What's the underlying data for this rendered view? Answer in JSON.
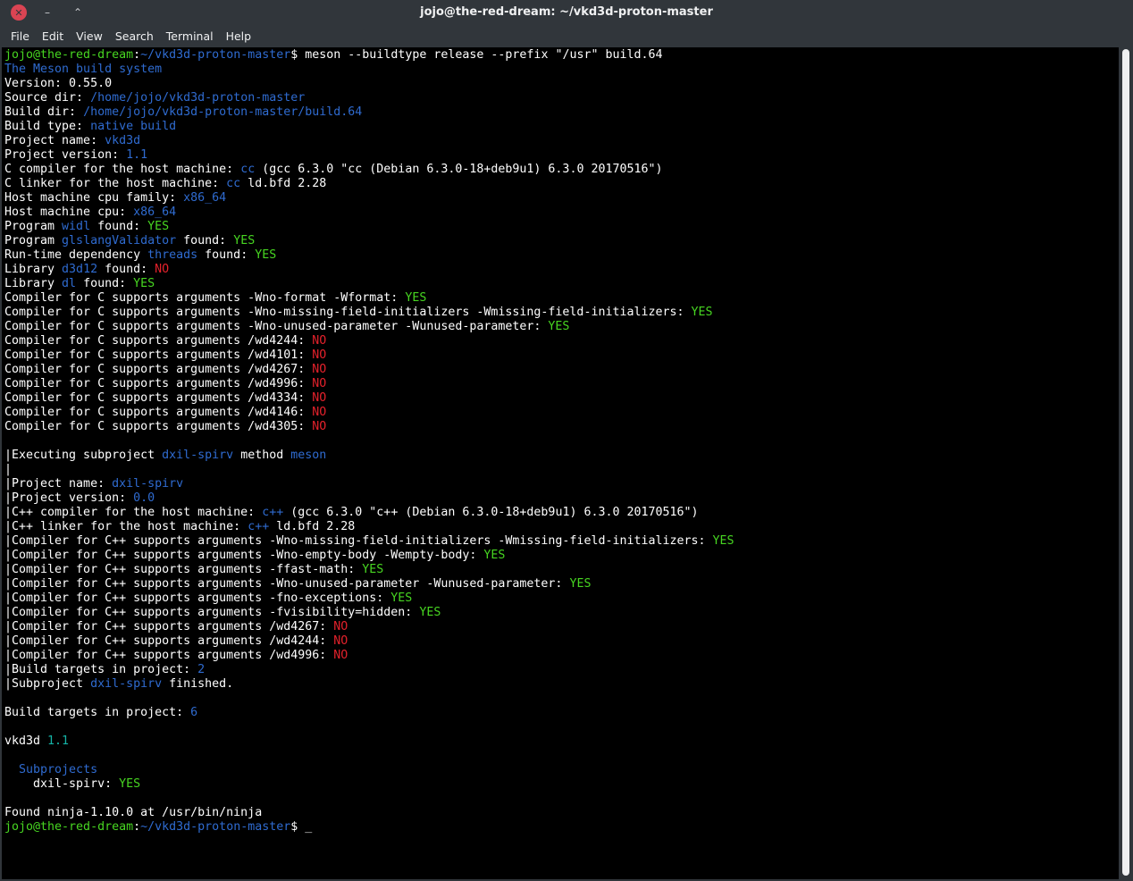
{
  "window": {
    "title": "jojo@the-red-dream: ~/vkd3d-proton-master",
    "close_glyph": "✕",
    "minimize_glyph": "–",
    "maximize_glyph": "⌃"
  },
  "menu": [
    "File",
    "Edit",
    "View",
    "Search",
    "Terminal",
    "Help"
  ],
  "colors": {
    "prompt_green": "#47d621",
    "info_blue": "#2f6bd0",
    "yes_green": "#47d621",
    "no_red": "#e3212b",
    "version_cyan": "#15b3a6"
  },
  "terminal": {
    "lines": [
      [
        [
          "jojo@the-red-dream",
          "green"
        ],
        [
          ":",
          "white"
        ],
        [
          "~/vkd3d-proton-master",
          "blue"
        ],
        [
          "$ meson --buildtype release --prefix \"/usr\" build.64",
          "white"
        ]
      ],
      [
        [
          "The Meson build system",
          "blue"
        ]
      ],
      [
        [
          "Version: 0.55.0",
          "white"
        ]
      ],
      [
        [
          "Source dir: ",
          "white"
        ],
        [
          "/home/jojo/vkd3d-proton-master",
          "blue"
        ]
      ],
      [
        [
          "Build dir: ",
          "white"
        ],
        [
          "/home/jojo/vkd3d-proton-master/build.64",
          "blue"
        ]
      ],
      [
        [
          "Build type: ",
          "white"
        ],
        [
          "native build",
          "blue"
        ]
      ],
      [
        [
          "Project name: ",
          "white"
        ],
        [
          "vkd3d",
          "blue"
        ]
      ],
      [
        [
          "Project version: ",
          "white"
        ],
        [
          "1.1",
          "blue"
        ]
      ],
      [
        [
          "C compiler for the host machine: ",
          "white"
        ],
        [
          "cc",
          "blue"
        ],
        [
          " (gcc 6.3.0 \"cc (Debian 6.3.0-18+deb9u1) 6.3.0 20170516\")",
          "white"
        ]
      ],
      [
        [
          "C linker for the host machine: ",
          "white"
        ],
        [
          "cc",
          "blue"
        ],
        [
          " ld.bfd 2.28",
          "white"
        ]
      ],
      [
        [
          "Host machine cpu family: ",
          "white"
        ],
        [
          "x86_64",
          "blue"
        ]
      ],
      [
        [
          "Host machine cpu: ",
          "white"
        ],
        [
          "x86_64",
          "blue"
        ]
      ],
      [
        [
          "Program ",
          "white"
        ],
        [
          "widl",
          "blue"
        ],
        [
          " found: ",
          "white"
        ],
        [
          "YES",
          "green"
        ]
      ],
      [
        [
          "Program ",
          "white"
        ],
        [
          "glslangValidator",
          "blue"
        ],
        [
          " found: ",
          "white"
        ],
        [
          "YES",
          "green"
        ]
      ],
      [
        [
          "Run-time dependency ",
          "white"
        ],
        [
          "threads",
          "blue"
        ],
        [
          " found: ",
          "white"
        ],
        [
          "YES",
          "green"
        ]
      ],
      [
        [
          "Library ",
          "white"
        ],
        [
          "d3d12",
          "blue"
        ],
        [
          " found: ",
          "white"
        ],
        [
          "NO",
          "red"
        ]
      ],
      [
        [
          "Library ",
          "white"
        ],
        [
          "dl",
          "blue"
        ],
        [
          " found: ",
          "white"
        ],
        [
          "YES",
          "green"
        ]
      ],
      [
        [
          "Compiler for C supports arguments -Wno-format -Wformat: ",
          "white"
        ],
        [
          "YES",
          "green"
        ]
      ],
      [
        [
          "Compiler for C supports arguments -Wno-missing-field-initializers -Wmissing-field-initializers: ",
          "white"
        ],
        [
          "YES",
          "green"
        ]
      ],
      [
        [
          "Compiler for C supports arguments -Wno-unused-parameter -Wunused-parameter: ",
          "white"
        ],
        [
          "YES",
          "green"
        ]
      ],
      [
        [
          "Compiler for C supports arguments /wd4244: ",
          "white"
        ],
        [
          "NO",
          "red"
        ]
      ],
      [
        [
          "Compiler for C supports arguments /wd4101: ",
          "white"
        ],
        [
          "NO",
          "red"
        ]
      ],
      [
        [
          "Compiler for C supports arguments /wd4267: ",
          "white"
        ],
        [
          "NO",
          "red"
        ]
      ],
      [
        [
          "Compiler for C supports arguments /wd4996: ",
          "white"
        ],
        [
          "NO",
          "red"
        ]
      ],
      [
        [
          "Compiler for C supports arguments /wd4334: ",
          "white"
        ],
        [
          "NO",
          "red"
        ]
      ],
      [
        [
          "Compiler for C supports arguments /wd4146: ",
          "white"
        ],
        [
          "NO",
          "red"
        ]
      ],
      [
        [
          "Compiler for C supports arguments /wd4305: ",
          "white"
        ],
        [
          "NO",
          "red"
        ]
      ],
      [],
      [
        [
          "|Executing subproject ",
          "white"
        ],
        [
          "dxil-spirv",
          "blue"
        ],
        [
          " method ",
          "white"
        ],
        [
          "meson",
          "blue"
        ]
      ],
      [
        [
          "|",
          "white"
        ]
      ],
      [
        [
          "|Project name: ",
          "white"
        ],
        [
          "dxil-spirv",
          "blue"
        ]
      ],
      [
        [
          "|Project version: ",
          "white"
        ],
        [
          "0.0",
          "blue"
        ]
      ],
      [
        [
          "|C++ compiler for the host machine: ",
          "white"
        ],
        [
          "c++",
          "blue"
        ],
        [
          " (gcc 6.3.0 \"c++ (Debian 6.3.0-18+deb9u1) 6.3.0 20170516\")",
          "white"
        ]
      ],
      [
        [
          "|C++ linker for the host machine: ",
          "white"
        ],
        [
          "c++",
          "blue"
        ],
        [
          " ld.bfd 2.28",
          "white"
        ]
      ],
      [
        [
          "|Compiler for C++ supports arguments -Wno-missing-field-initializers -Wmissing-field-initializers: ",
          "white"
        ],
        [
          "YES",
          "green"
        ]
      ],
      [
        [
          "|Compiler for C++ supports arguments -Wno-empty-body -Wempty-body: ",
          "white"
        ],
        [
          "YES",
          "green"
        ]
      ],
      [
        [
          "|Compiler for C++ supports arguments -ffast-math: ",
          "white"
        ],
        [
          "YES",
          "green"
        ]
      ],
      [
        [
          "|Compiler for C++ supports arguments -Wno-unused-parameter -Wunused-parameter: ",
          "white"
        ],
        [
          "YES",
          "green"
        ]
      ],
      [
        [
          "|Compiler for C++ supports arguments -fno-exceptions: ",
          "white"
        ],
        [
          "YES",
          "green"
        ]
      ],
      [
        [
          "|Compiler for C++ supports arguments -fvisibility=hidden: ",
          "white"
        ],
        [
          "YES",
          "green"
        ]
      ],
      [
        [
          "|Compiler for C++ supports arguments /wd4267: ",
          "white"
        ],
        [
          "NO",
          "red"
        ]
      ],
      [
        [
          "|Compiler for C++ supports arguments /wd4244: ",
          "white"
        ],
        [
          "NO",
          "red"
        ]
      ],
      [
        [
          "|Compiler for C++ supports arguments /wd4996: ",
          "white"
        ],
        [
          "NO",
          "red"
        ]
      ],
      [
        [
          "|Build targets in project: ",
          "white"
        ],
        [
          "2",
          "blue"
        ]
      ],
      [
        [
          "|Subproject ",
          "white"
        ],
        [
          "dxil-spirv",
          "blue"
        ],
        [
          " finished.",
          "white"
        ]
      ],
      [],
      [
        [
          "Build targets in project: ",
          "white"
        ],
        [
          "6",
          "blue"
        ]
      ],
      [],
      [
        [
          "vkd3d ",
          "white"
        ],
        [
          "1.1",
          "cyan"
        ]
      ],
      [],
      [
        [
          "  ",
          "white"
        ],
        [
          "Subprojects",
          "blue"
        ]
      ],
      [
        [
          "    dxil-spirv: ",
          "white"
        ],
        [
          "YES",
          "green"
        ]
      ],
      [],
      [
        [
          "Found ninja-1.10.0 at /usr/bin/ninja",
          "white"
        ]
      ],
      [
        [
          "jojo@the-red-dream",
          "green"
        ],
        [
          ":",
          "white"
        ],
        [
          "~/vkd3d-proton-master",
          "blue"
        ],
        [
          "$ ",
          "white"
        ],
        [
          "_",
          "white"
        ]
      ]
    ]
  }
}
